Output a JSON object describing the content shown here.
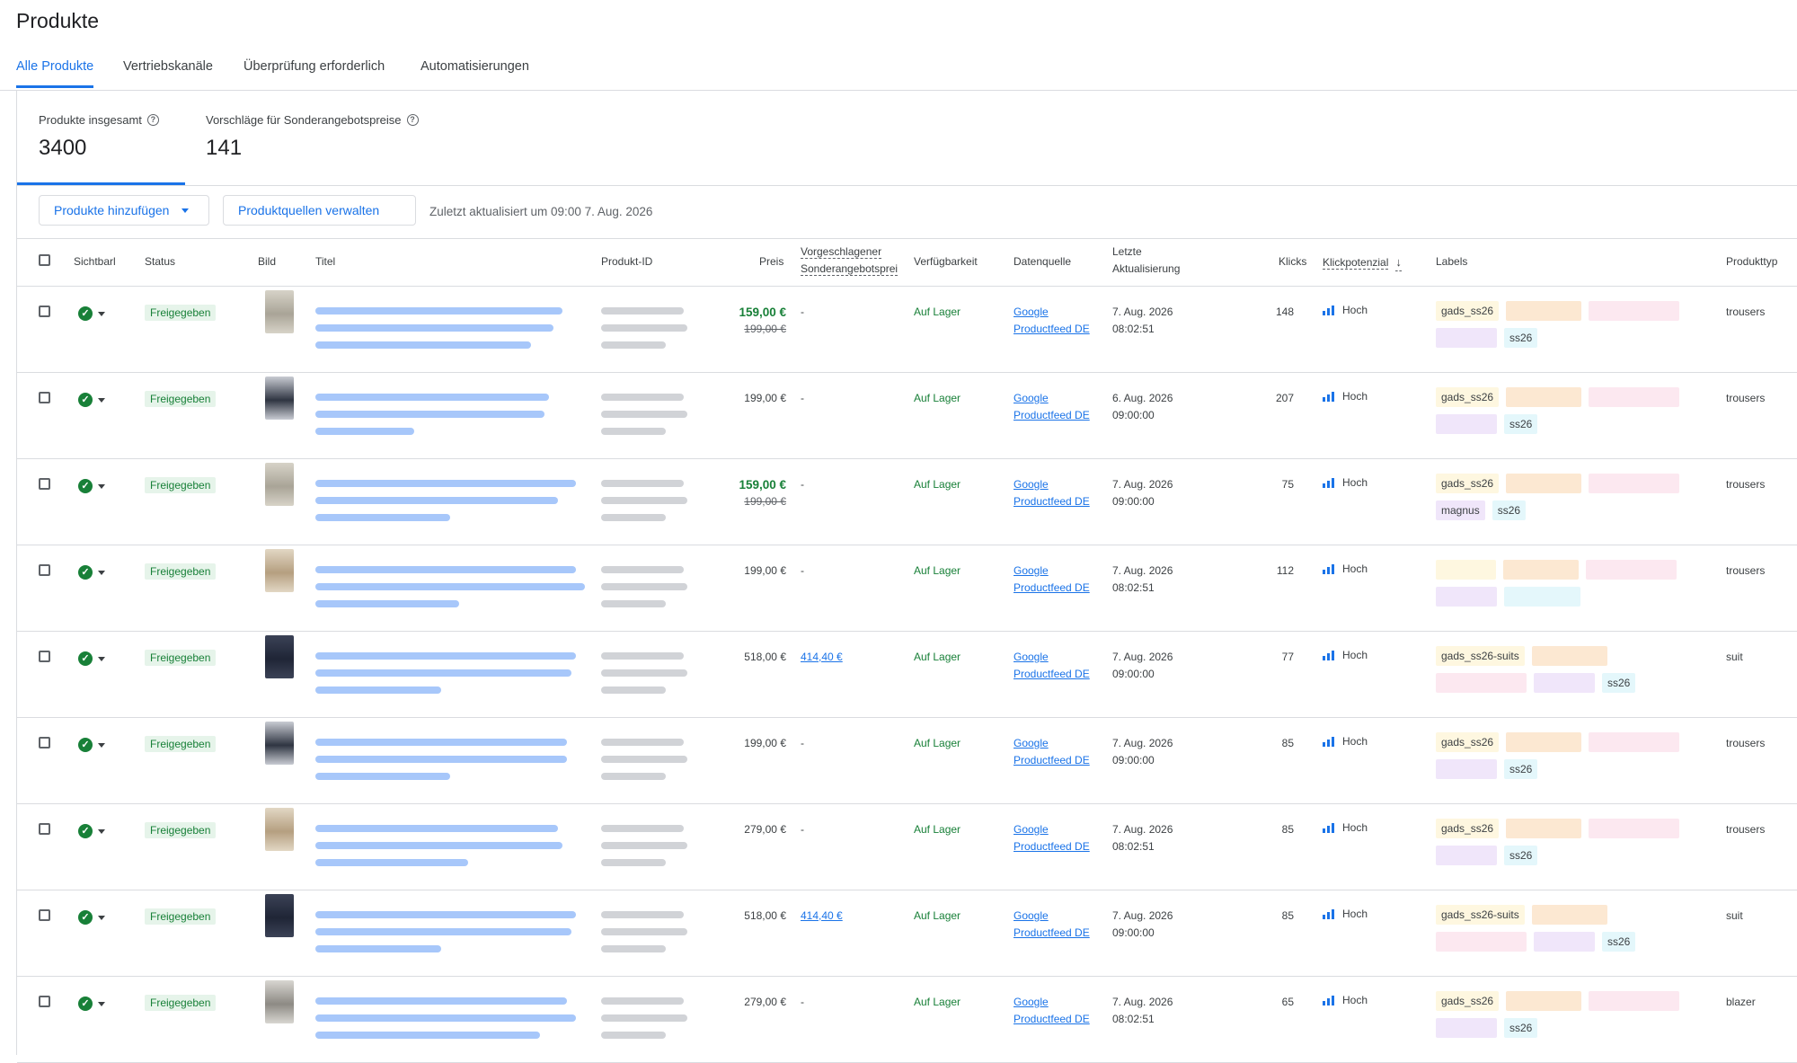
{
  "page": {
    "title": "Produkte"
  },
  "tabs": [
    {
      "label": "Alle Produkte",
      "active": true
    },
    {
      "label": "Vertriebskanäle",
      "active": false
    },
    {
      "label": "Überprüfung erforderlich",
      "active": false
    },
    {
      "label": "Automatisierungen",
      "active": false
    }
  ],
  "stats": {
    "total": {
      "label": "Produkte insgesamt",
      "value": "3400"
    },
    "suggestions": {
      "label": "Vorschläge für Sonderangebotspreise",
      "value": "141"
    }
  },
  "toolbar": {
    "add_label": "Produkte hinzufügen",
    "manage_label": "Produktquellen verwalten",
    "updated": "Zuletzt aktualisiert um 09:00 7. Aug. 2026"
  },
  "columns": {
    "visibility": "Sichtbarl",
    "status": "Status",
    "image": "Bild",
    "title": "Titel",
    "product_id": "Produkt-ID",
    "price": "Preis",
    "suggested_1": "Vorgeschlagener",
    "suggested_2": "Sonderangebotsprei",
    "availability": "Verfügbarkeit",
    "source": "Datenquelle",
    "updated_1": "Letzte",
    "updated_2": "Aktualisierung",
    "clicks": "Klicks",
    "click_potential": "Klickpotenzial",
    "labels": "Labels",
    "product_type": "Produkttyp"
  },
  "rows": [
    {
      "status": "Freigegeben",
      "price_sale": "159,00 €",
      "price_old": "199,00 €",
      "price": "",
      "suggested": "-",
      "availability": "Auf Lager",
      "source_1": "Google",
      "source_2": "Productfeed DE",
      "date": "7. Aug. 2026",
      "time": "08:02:51",
      "clicks": "148",
      "potential": "Hoch",
      "labels": [
        {
          "text": "gads_ss26",
          "color": "yellow",
          "blur": false
        },
        {
          "text": "xxxxx",
          "color": "orange",
          "blur": true
        },
        {
          "text": "xxx",
          "color": "pink",
          "blur": true
        },
        {
          "text": "xx",
          "color": "purple",
          "blur": true
        },
        {
          "text": "ss26",
          "color": "teal",
          "blur": false
        }
      ],
      "type": "trousers",
      "thumb": "light"
    },
    {
      "status": "Freigegeben",
      "price_sale": "",
      "price_old": "",
      "price": "199,00 €",
      "suggested": "-",
      "availability": "Auf Lager",
      "source_1": "Google",
      "source_2": "Productfeed DE",
      "date": "6. Aug. 2026",
      "time": "09:00:00",
      "clicks": "207",
      "potential": "Hoch",
      "labels": [
        {
          "text": "gads_ss26",
          "color": "yellow",
          "blur": false
        },
        {
          "text": "xxxxx",
          "color": "orange",
          "blur": true
        },
        {
          "text": "xxx",
          "color": "pink",
          "blur": true
        },
        {
          "text": "xx",
          "color": "purple",
          "blur": true
        },
        {
          "text": "ss26",
          "color": "teal",
          "blur": false
        }
      ],
      "type": "trousers",
      "thumb": "dark"
    },
    {
      "status": "Freigegeben",
      "price_sale": "159,00 €",
      "price_old": "199,00 €",
      "price": "",
      "suggested": "-",
      "availability": "Auf Lager",
      "source_1": "Google",
      "source_2": "Productfeed DE",
      "date": "7. Aug. 2026",
      "time": "09:00:00",
      "clicks": "75",
      "potential": "Hoch",
      "labels": [
        {
          "text": "gads_ss26",
          "color": "yellow",
          "blur": false
        },
        {
          "text": "xxxxx",
          "color": "orange",
          "blur": true
        },
        {
          "text": "xxx",
          "color": "pink",
          "blur": true
        },
        {
          "text": "magnus",
          "color": "purple",
          "blur": false
        },
        {
          "text": "ss26",
          "color": "teal",
          "blur": false
        }
      ],
      "type": "trousers",
      "thumb": "light"
    },
    {
      "status": "Freigegeben",
      "price_sale": "",
      "price_old": "",
      "price": "199,00 €",
      "suggested": "-",
      "availability": "Auf Lager",
      "source_1": "Google",
      "source_2": "Productfeed DE",
      "date": "7. Aug. 2026",
      "time": "08:02:51",
      "clicks": "112",
      "potential": "Hoch",
      "labels": [
        {
          "text": "xxxx",
          "color": "yellow",
          "blur": true
        },
        {
          "text": "xxxxx",
          "color": "orange",
          "blur": true
        },
        {
          "text": "xxx",
          "color": "pink",
          "blur": true
        },
        {
          "text": "xx",
          "color": "purple",
          "blur": true
        },
        {
          "text": "xx",
          "color": "teal",
          "blur": true
        }
      ],
      "type": "trousers",
      "thumb": "beige"
    },
    {
      "status": "Freigegeben",
      "price_sale": "",
      "price_old": "",
      "price": "518,00 €",
      "suggested": "414,40 €",
      "availability": "Auf Lager",
      "source_1": "Google",
      "source_2": "Productfeed DE",
      "date": "7. Aug. 2026",
      "time": "09:00:00",
      "clicks": "77",
      "potential": "Hoch",
      "labels": [
        {
          "text": "gads_ss26-suits",
          "color": "yellow",
          "blur": false
        },
        {
          "text": "xxxxx",
          "color": "orange",
          "blur": true
        },
        {
          "text": "xxxx",
          "color": "pink",
          "blur": true
        },
        {
          "text": "xxx",
          "color": "purple",
          "blur": true
        },
        {
          "text": "ss26",
          "color": "teal",
          "blur": false
        }
      ],
      "type": "suit",
      "thumb": "navy"
    },
    {
      "status": "Freigegeben",
      "price_sale": "",
      "price_old": "",
      "price": "199,00 €",
      "suggested": "-",
      "availability": "Auf Lager",
      "source_1": "Google",
      "source_2": "Productfeed DE",
      "date": "7. Aug. 2026",
      "time": "09:00:00",
      "clicks": "85",
      "potential": "Hoch",
      "labels": [
        {
          "text": "gads_ss26",
          "color": "yellow",
          "blur": false
        },
        {
          "text": "xxxxx",
          "color": "orange",
          "blur": true
        },
        {
          "text": "xxx",
          "color": "pink",
          "blur": true
        },
        {
          "text": "xx",
          "color": "purple",
          "blur": true
        },
        {
          "text": "ss26",
          "color": "teal",
          "blur": false
        }
      ],
      "type": "trousers",
      "thumb": "dark"
    },
    {
      "status": "Freigegeben",
      "price_sale": "",
      "price_old": "",
      "price": "279,00 €",
      "suggested": "-",
      "availability": "Auf Lager",
      "source_1": "Google",
      "source_2": "Productfeed DE",
      "date": "7. Aug. 2026",
      "time": "08:02:51",
      "clicks": "85",
      "potential": "Hoch",
      "labels": [
        {
          "text": "gads_ss26",
          "color": "yellow",
          "blur": false
        },
        {
          "text": "xxxxx",
          "color": "orange",
          "blur": true
        },
        {
          "text": "xxxx",
          "color": "pink",
          "blur": true
        },
        {
          "text": "xx",
          "color": "purple",
          "blur": true
        },
        {
          "text": "ss26",
          "color": "teal",
          "blur": false
        }
      ],
      "type": "trousers",
      "thumb": "beige"
    },
    {
      "status": "Freigegeben",
      "price_sale": "",
      "price_old": "",
      "price": "518,00 €",
      "suggested": "414,40 €",
      "availability": "Auf Lager",
      "source_1": "Google",
      "source_2": "Productfeed DE",
      "date": "7. Aug. 2026",
      "time": "09:00:00",
      "clicks": "85",
      "potential": "Hoch",
      "labels": [
        {
          "text": "gads_ss26-suits",
          "color": "yellow",
          "blur": false
        },
        {
          "text": "xxxxx",
          "color": "orange",
          "blur": true
        },
        {
          "text": "xxxx",
          "color": "pink",
          "blur": true
        },
        {
          "text": "xxx",
          "color": "purple",
          "blur": true
        },
        {
          "text": "ss26",
          "color": "teal",
          "blur": false
        }
      ],
      "type": "suit",
      "thumb": "navy"
    },
    {
      "status": "Freigegeben",
      "price_sale": "",
      "price_old": "",
      "price": "279,00 €",
      "suggested": "-",
      "availability": "Auf Lager",
      "source_1": "Google",
      "source_2": "Productfeed DE",
      "date": "7. Aug. 2026",
      "time": "08:02:51",
      "clicks": "65",
      "potential": "Hoch",
      "labels": [
        {
          "text": "gads_ss26",
          "color": "yellow",
          "blur": false
        },
        {
          "text": "xxxxx",
          "color": "orange",
          "blur": true
        },
        {
          "text": "xxxx",
          "color": "pink",
          "blur": true
        },
        {
          "text": "xx",
          "color": "purple",
          "blur": true
        },
        {
          "text": "ss26",
          "color": "teal",
          "blur": false
        }
      ],
      "type": "blazer",
      "thumb": "grey"
    }
  ]
}
